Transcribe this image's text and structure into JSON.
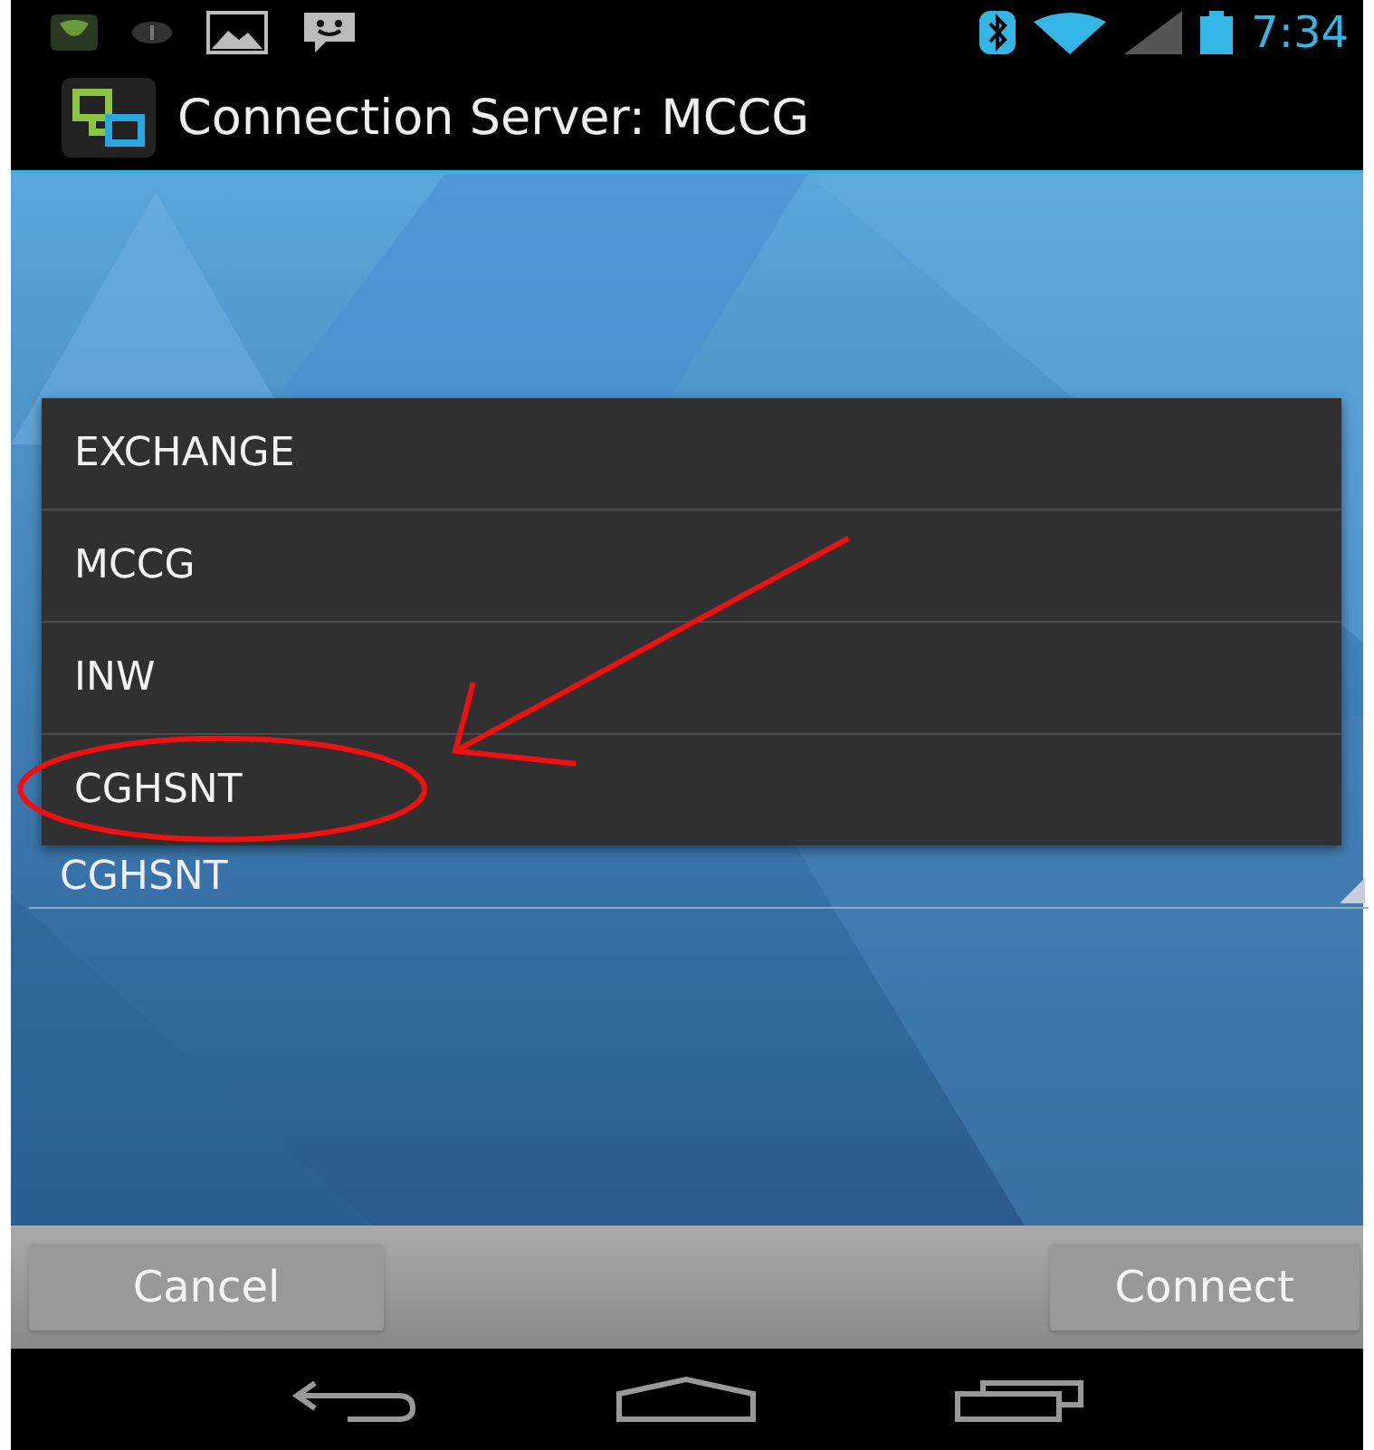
{
  "status_bar": {
    "time": "7:34"
  },
  "title_bar": {
    "title": "Connection Server: MCCG"
  },
  "spinner": {
    "value": "CGHSNT"
  },
  "dropdown": {
    "items": [
      {
        "label": "EXCHANGE"
      },
      {
        "label": "MCCG"
      },
      {
        "label": "INW"
      },
      {
        "label": "CGHSNT"
      }
    ]
  },
  "buttons": [
    {
      "label": "Cancel"
    },
    {
      "label": "Connect"
    }
  ]
}
